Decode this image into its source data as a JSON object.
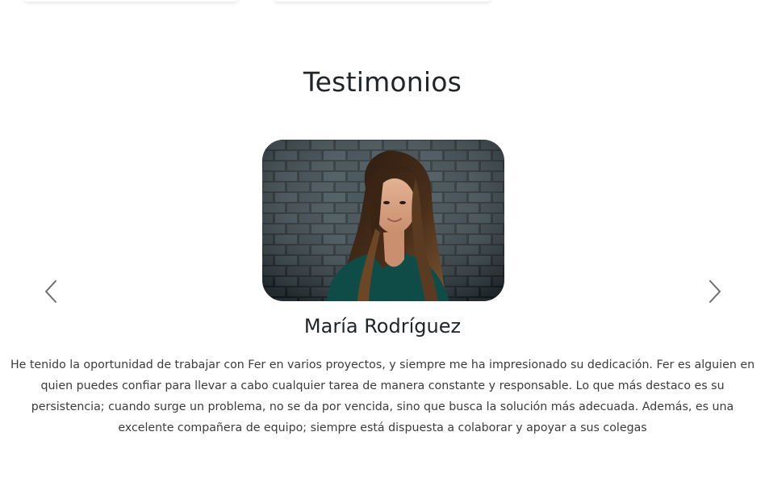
{
  "section": {
    "title": "Testimonios"
  },
  "testimonial": {
    "name": "María Rodríguez",
    "quote": "He tenido la oportunidad de trabajar con Fer en varios proyectos, y siempre me ha impresionado su dedicación. Fer es alguien en quien puedes confiar para llevar a cabo cualquier tarea de manera constante y responsable. Lo que más destaco es su persistencia; cuando surge un problema, no se da por vencida, sino que busca la solución más adecuada. Además, es una excelente compañera de equipo; siempre está dispuesta a colaborar y apoyar a sus colegas",
    "photo_alt": "María Rodríguez"
  },
  "carousel": {
    "prev_icon": "chevron-left-icon",
    "next_icon": "chevron-right-icon"
  },
  "colors": {
    "text": "#212529",
    "body_text": "#3b3b3b",
    "arrow": "#6c6c6c",
    "background": "#ffffff"
  }
}
